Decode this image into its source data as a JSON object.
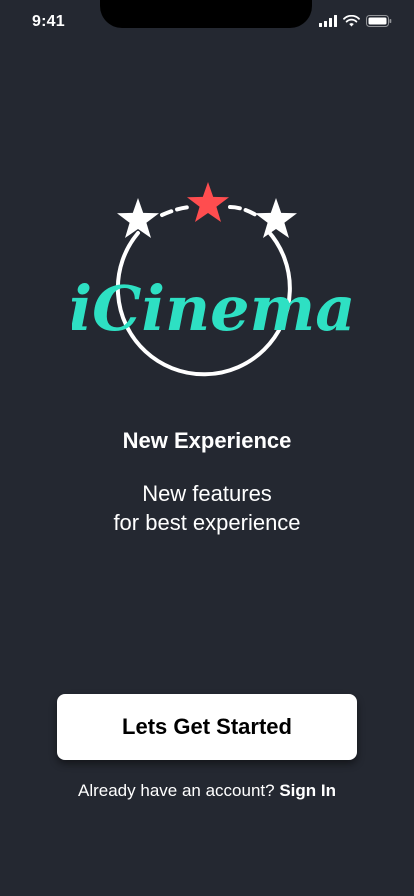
{
  "status_bar": {
    "time": "9:41",
    "icons": [
      "cellular-signal-icon",
      "wifi-icon",
      "battery-icon"
    ]
  },
  "logo": {
    "text": "iCinema",
    "colors": {
      "text": "#2ee0c3",
      "star_white": "#ffffff",
      "star_red": "#ff4d4f",
      "ring": "#ffffff"
    }
  },
  "onboarding": {
    "title": "New Experience",
    "subtitle_line1": "New features",
    "subtitle_line2": "for best experience"
  },
  "cta": {
    "label": "Lets Get Started"
  },
  "signin": {
    "prompt": "Already have an account?",
    "link": "Sign In"
  },
  "colors": {
    "background": "#242831",
    "button_bg": "#ffffff",
    "button_text": "#000000"
  }
}
